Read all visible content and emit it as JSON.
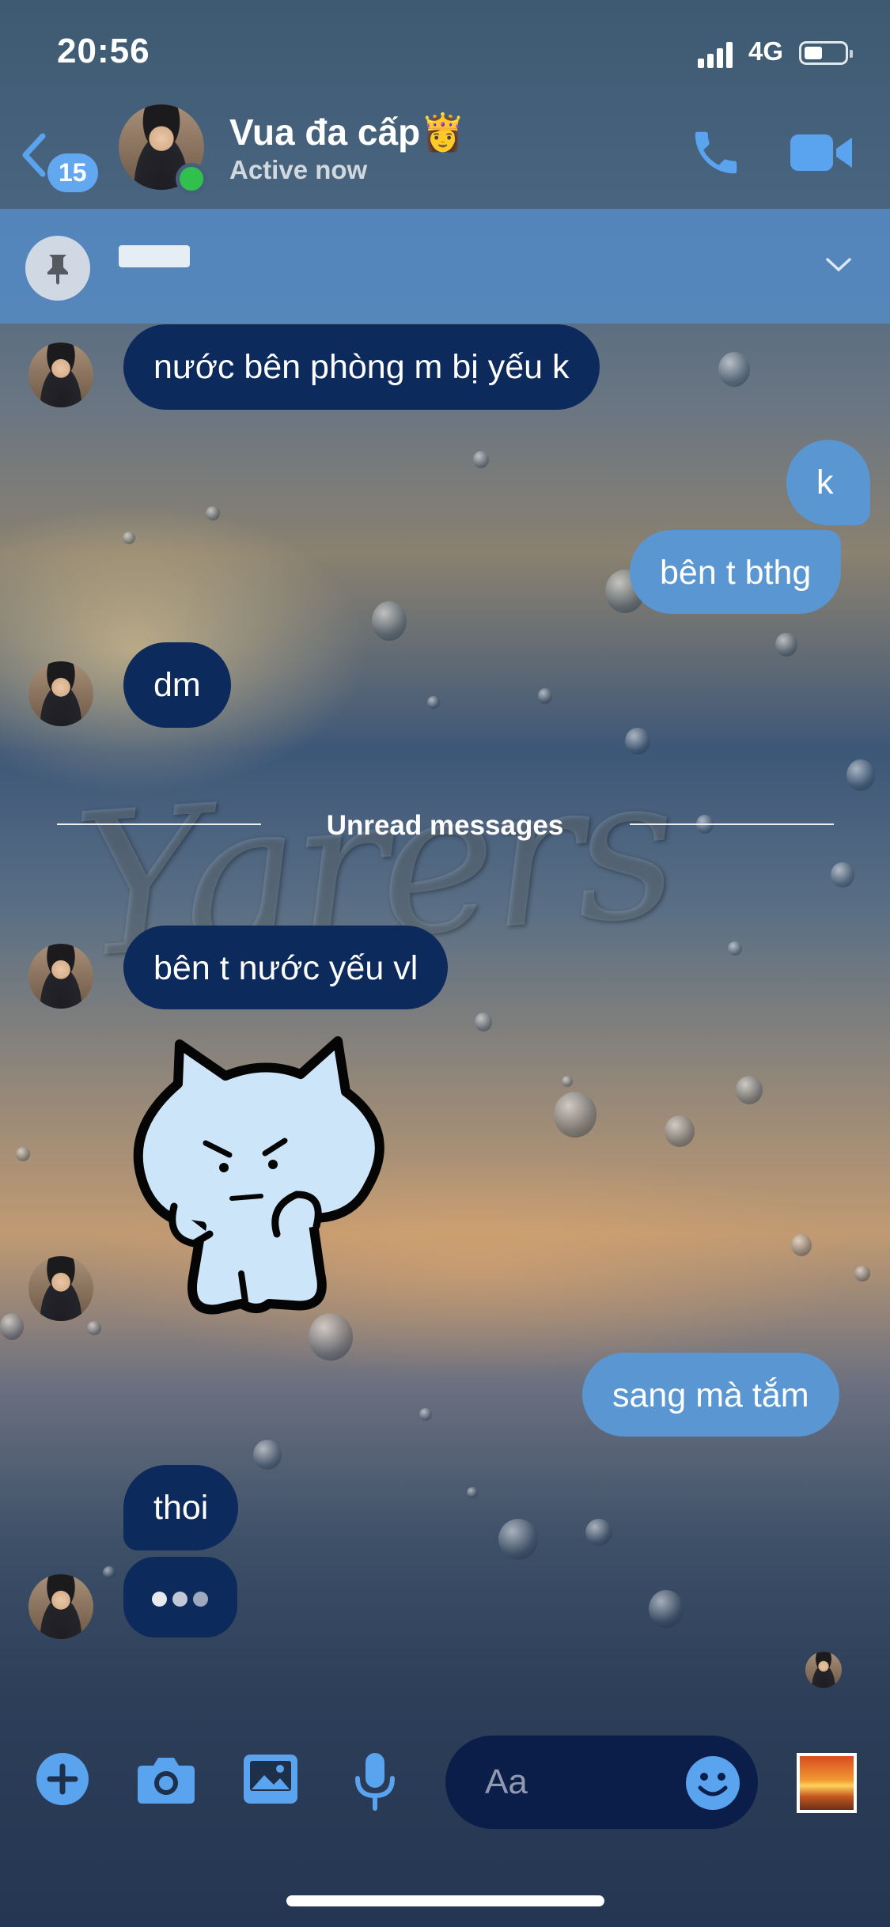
{
  "status_bar": {
    "time": "20:56",
    "network": "4G"
  },
  "header": {
    "back_count": "15",
    "contact_name": "Vua đa cấp👸",
    "contact_status": "Active now"
  },
  "divider": {
    "label": "Unread messages"
  },
  "messages": [
    {
      "text": "nước bên phòng m bị yếu k"
    },
    {
      "text": "k"
    },
    {
      "text": "bên t bthg"
    },
    {
      "text": "dm"
    },
    {
      "text": "bên t nước yếu vl"
    },
    {
      "text": "sang mà tắm"
    },
    {
      "text": "thoi"
    }
  ],
  "composer": {
    "placeholder": "Aa"
  },
  "colors": {
    "incoming_bubble": "#0d2a5c",
    "outgoing_bubble": "#5a96d2",
    "accent": "#62a8f0",
    "pinned_bar": "#568cc8"
  }
}
